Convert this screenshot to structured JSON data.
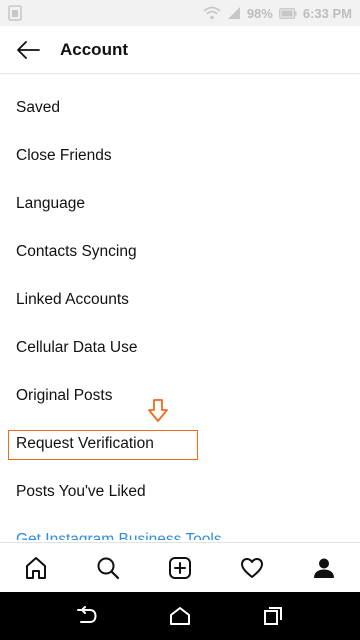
{
  "status_bar": {
    "battery": "98%",
    "time": "6:33 PM",
    "icons": [
      "sim-icon",
      "wifi-icon",
      "signal-icon",
      "battery-icon"
    ]
  },
  "header": {
    "title": "Account",
    "back_icon": "back-arrow-icon"
  },
  "menu": {
    "items": [
      {
        "label": "Saved"
      },
      {
        "label": "Close Friends"
      },
      {
        "label": "Language"
      },
      {
        "label": "Contacts Syncing"
      },
      {
        "label": "Linked Accounts"
      },
      {
        "label": "Cellular Data Use"
      },
      {
        "label": "Original Posts"
      },
      {
        "label": "Request Verification"
      },
      {
        "label": "Posts You've Liked"
      },
      {
        "label": "Get Instagram Business Tools"
      }
    ],
    "link_color": "#2f8de4"
  },
  "annotation": {
    "highlight_color": "#f26b1d",
    "arrow_icon": "down-arrow-icon"
  },
  "bottom_nav": {
    "icons": [
      "home-icon",
      "search-icon",
      "add-post-icon",
      "heart-icon",
      "profile-icon"
    ]
  },
  "system_nav": {
    "icons": [
      "back-icon",
      "home-icon",
      "recents-icon"
    ]
  }
}
